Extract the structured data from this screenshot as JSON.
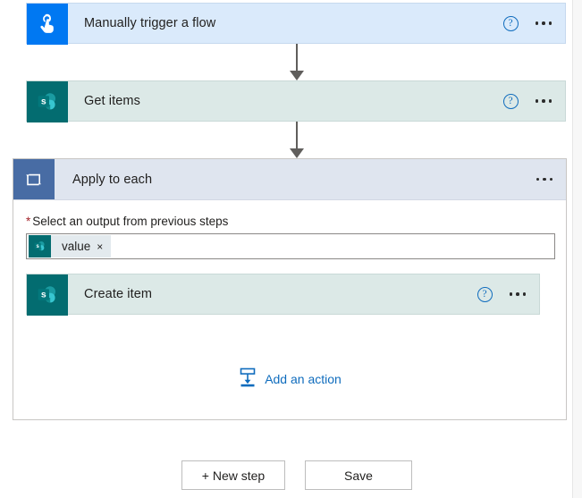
{
  "flow": {
    "trigger": {
      "title": "Manually trigger a flow",
      "icon": "touch-trigger-icon",
      "icon_bg": "#0078f2",
      "card_bg": "#daeafb",
      "help_glyph": "?",
      "has_help": true,
      "has_menu": true
    },
    "get_items": {
      "title": "Get items",
      "icon": "sharepoint-icon",
      "icon_bg": "#036c70",
      "card_bg": "#dce9e7",
      "help_glyph": "?",
      "has_help": true,
      "has_menu": true
    },
    "apply_to_each": {
      "title": "Apply to each",
      "icon": "loop-icon",
      "icon_bg": "#486ca4",
      "header_bg": "#dfe5ef",
      "has_help": false,
      "has_menu": true,
      "field": {
        "required_marker": "*",
        "label": "Select an output from previous steps",
        "token": {
          "text": "value",
          "remove_glyph": "×",
          "icon": "sharepoint-icon"
        }
      },
      "nested_action": {
        "title": "Create item",
        "icon": "sharepoint-icon",
        "icon_bg": "#036c70",
        "card_bg": "#dce9e7",
        "help_glyph": "?",
        "has_help": true,
        "has_menu": true
      },
      "add_action": {
        "label": "Add an action",
        "icon": "insert-action-icon",
        "color": "#0f6cbd"
      }
    }
  },
  "footer": {
    "new_step_label": "+ New step",
    "save_label": "Save"
  },
  "colors": {
    "accent_blue": "#0f6cbd",
    "sharepoint_teal": "#036c70",
    "loop_slate": "#486ca4",
    "required_red": "#a4262c",
    "connector_gray": "#605e5c",
    "page_bg": "#f7f7f7"
  }
}
